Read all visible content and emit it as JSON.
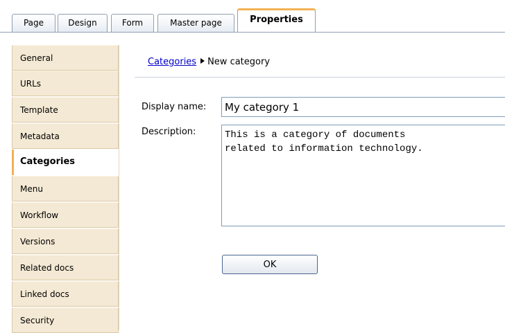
{
  "tabs": [
    {
      "label": "Page"
    },
    {
      "label": "Design"
    },
    {
      "label": "Form"
    },
    {
      "label": "Master page"
    },
    {
      "label": "Properties"
    }
  ],
  "sidebar": {
    "items": [
      {
        "label": "General"
      },
      {
        "label": "URLs"
      },
      {
        "label": "Template"
      },
      {
        "label": "Metadata"
      },
      {
        "label": "Categories"
      },
      {
        "label": "Menu"
      },
      {
        "label": "Workflow"
      },
      {
        "label": "Versions"
      },
      {
        "label": "Related docs"
      },
      {
        "label": "Linked docs"
      },
      {
        "label": "Security"
      }
    ]
  },
  "breadcrumb": {
    "link": "Categories",
    "current": "New category"
  },
  "form": {
    "display_name_label": "Display name:",
    "display_name_value": "My category 1",
    "description_label": "Description:",
    "description_value": "This is a category of documents\nrelated to information technology.",
    "ok_label": "OK"
  },
  "colors": {
    "accent": "#f3b153",
    "sidebar_bg": "#f4e9d4",
    "link": "#0000cc"
  }
}
